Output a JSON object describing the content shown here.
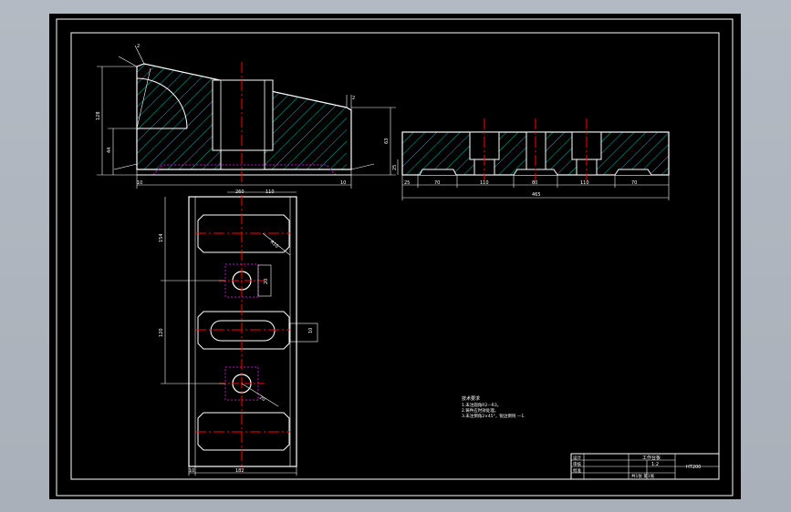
{
  "drawing": {
    "colors": {
      "background": "#000000",
      "frame": "#ffffff",
      "centerline": "#ff0000",
      "hatch": "#00b3b3",
      "hidden": "#cc00cc",
      "text": "#ffffff"
    },
    "side_view": {
      "dims": {
        "height_total": "128",
        "height_left": "44",
        "height_right": "63",
        "foot_left": "10",
        "foot_right": "10",
        "bottom_overall": "260",
        "chamfer_top": "2",
        "chamfer_right": "2"
      }
    },
    "front_section": {
      "dims": {
        "step": "25",
        "seg1": "70",
        "seg2": "110",
        "seg3": "80",
        "seg4": "110",
        "seg5": "70",
        "overall": "465",
        "left_height": "25"
      }
    },
    "plan_view": {
      "dims": {
        "top_width": "110",
        "left_top": "154",
        "left_mid": "120",
        "radius": "R10",
        "side_tab": "10",
        "bottom_width": "182",
        "bottom_left": "10",
        "hole_tab": "20",
        "hole_dia": "20"
      }
    },
    "notes": {
      "title": "技术要求",
      "line1": "1.未注圆角R2—R3。",
      "line2": "2.铸件应时效处理。",
      "line3": "3.未注倒角2×45°，锐边倒钝 —1."
    },
    "title_block": {
      "part_name": "工作台板",
      "scale": "1:2",
      "material": "HT200",
      "label_design": "设计",
      "label_check": "审核",
      "label_approve": "批准",
      "label_qty": "共1张 第1张"
    }
  }
}
